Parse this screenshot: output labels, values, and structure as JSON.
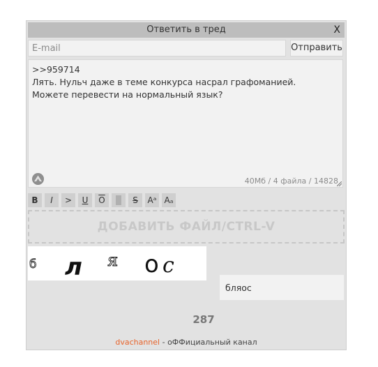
{
  "dialog": {
    "title": "Ответить в тред",
    "close_label": "X"
  },
  "email": {
    "placeholder": "E-mail",
    "value": ""
  },
  "send_label": "Отправить",
  "message": {
    "text": ">>959714\nЛять. Нульч даже в теме конкурса насрал графоманией. Можете перевести на нормальный язык?",
    "logo_icon": "dvach-logo-icon",
    "counter": "40Мб / 4 файла / 14828"
  },
  "markup_buttons": [
    {
      "label": "B",
      "name": "bold"
    },
    {
      "label": "I",
      "name": "italic"
    },
    {
      "label": ">",
      "name": "quote"
    },
    {
      "label": "U",
      "name": "underline"
    },
    {
      "label": "O",
      "name": "overline"
    },
    {
      "label": "",
      "name": "spoiler"
    },
    {
      "label": "S",
      "name": "strikethrough"
    },
    {
      "label": "Aᵃ",
      "name": "superscript"
    },
    {
      "label": "Aₐ",
      "name": "subscript"
    }
  ],
  "dropzone_label": "ДОБАВИТЬ ФАЙЛ/CTRL-V",
  "captcha": {
    "chars": [
      "б",
      "л",
      "я",
      "о",
      "с"
    ],
    "value": "бляос"
  },
  "post_count": "287",
  "footer": {
    "link": "dvachannel",
    "suffix": " - оФФициальный канал"
  },
  "colors": {
    "dialog_bg": "#e2e2e2",
    "title_bg": "#bdbdbd",
    "footer_link": "#e8642c"
  }
}
